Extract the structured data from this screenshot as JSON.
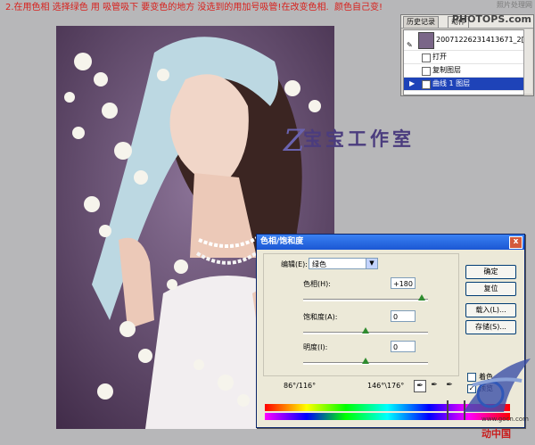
{
  "instruction": "2.在用色相 选择绿色 用 吸管吸下 要变色的地方 没选到的用加号吸管!在改变色相.  颜色自己变!",
  "site_label": "照片处理网",
  "watermark": {
    "glyph": "Z",
    "text": "宝宝工作室"
  },
  "history_panel": {
    "tabs": [
      "历史记录",
      "动作"
    ],
    "logo": "PHOTOPS.com",
    "snapshot": "20071226231413671_2[1",
    "items": [
      {
        "label": "打开",
        "selected": false
      },
      {
        "label": "复制图层",
        "selected": false
      },
      {
        "label": "曲线 1 图层",
        "selected": true
      }
    ]
  },
  "dialog": {
    "title": "色相/饱和度",
    "close": "x",
    "edit_label": "编辑(E):",
    "edit_value": "绿色",
    "hue_label": "色相(H):",
    "hue_value": "+180",
    "hue_level": 0.95,
    "saturation_label": "饱和度(A):",
    "saturation_value": "0",
    "saturation_level": 0.5,
    "lightness_label": "明度(I):",
    "lightness_value": "0",
    "lightness_level": 0.5,
    "buttons": {
      "ok": "确定",
      "reset": "复位",
      "load": "载入(L)...",
      "save": "存储(S)..."
    },
    "colorize_label": "着色",
    "preview_label": "预览",
    "range_left": "86°/116°",
    "range_right": "146°\\176°",
    "accent": "#1e43b8"
  },
  "brand": {
    "url": "www.gocn.com",
    "text": "动中国"
  }
}
